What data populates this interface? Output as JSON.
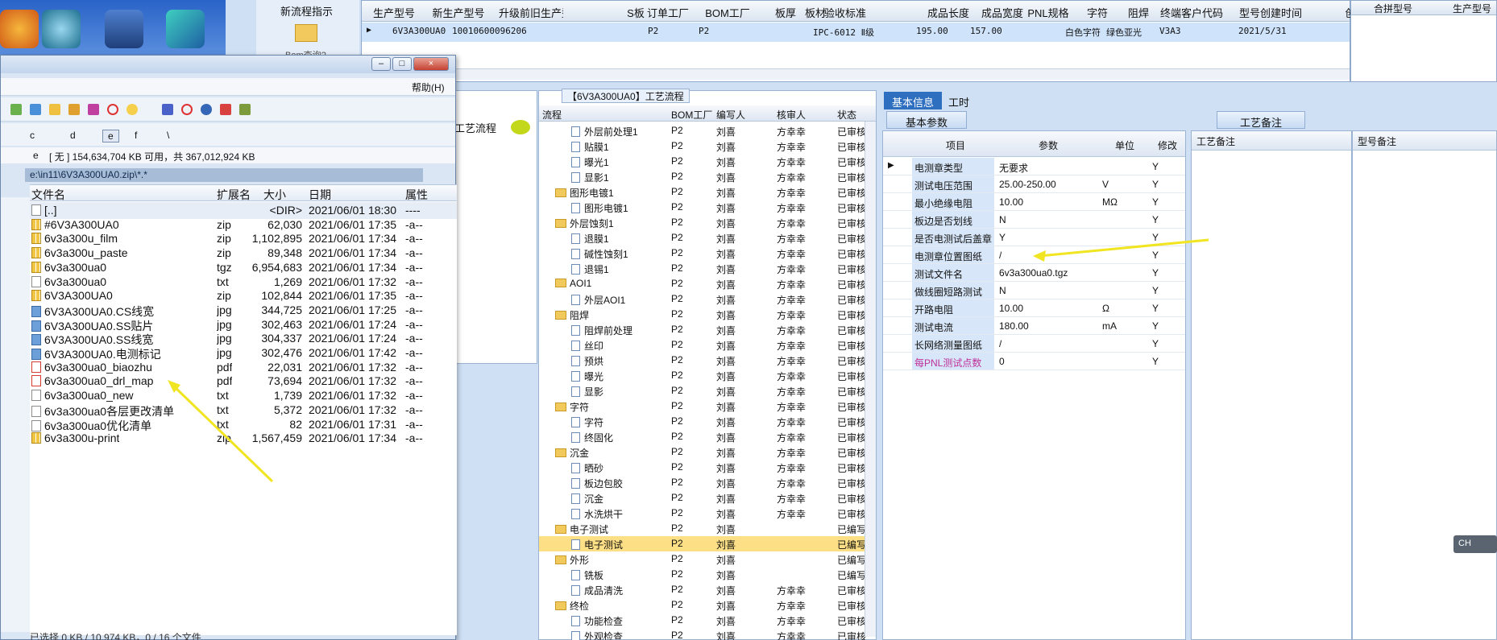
{
  "top_grid": {
    "headers": [
      "生产型号",
      "新生产型号",
      "升级前旧生产型号",
      "S板",
      "订单工厂",
      "BOM工厂",
      "板厚",
      "板材",
      "验收标准",
      "成品长度",
      "成品宽度",
      "PNL规格",
      "字符",
      "阻焊",
      "终端客户代码",
      "型号创建时间",
      "创建人"
    ],
    "row": {
      "model": "6V3A300UA0",
      "new_model": "10010600096206",
      "order_factory": "P2",
      "bom_factory": "P2",
      "standard": "IPC-6012 Ⅱ级",
      "length": "195.00",
      "width": "157.00",
      "char": "白色字符",
      "solder": "绿色亚光",
      "customer": "V3A3",
      "created": "2021/5/31"
    }
  },
  "right_top": {
    "headers": [
      "合拼型号",
      "生产型号"
    ]
  },
  "new_flow": {
    "label": "新流程指示",
    "bom_label": "Bom查询?"
  },
  "left_panel": {
    "label": "工艺流程"
  },
  "flow": {
    "tag": "【6V3A300UA0】工艺流程",
    "headers": [
      "流程",
      "BOM工厂",
      "编写人",
      "核审人",
      "状态"
    ],
    "rows": [
      {
        "name": "外层前处理1",
        "type": "doc",
        "f": "P2",
        "w": "刘喜",
        "a": "方幸幸",
        "s": "已审核"
      },
      {
        "name": "贴膜1",
        "type": "doc",
        "f": "P2",
        "w": "刘喜",
        "a": "方幸幸",
        "s": "已审核"
      },
      {
        "name": "曝光1",
        "type": "doc",
        "f": "P2",
        "w": "刘喜",
        "a": "方幸幸",
        "s": "已审核"
      },
      {
        "name": "显影1",
        "type": "doc",
        "f": "P2",
        "w": "刘喜",
        "a": "方幸幸",
        "s": "已审核"
      },
      {
        "name": "图形电镀1",
        "type": "folder",
        "f": "P2",
        "w": "刘喜",
        "a": "方幸幸",
        "s": "已审核"
      },
      {
        "name": "图形电镀1",
        "type": "doc",
        "f": "P2",
        "w": "刘喜",
        "a": "方幸幸",
        "s": "已审核"
      },
      {
        "name": "外层蚀刻1",
        "type": "folder",
        "f": "P2",
        "w": "刘喜",
        "a": "方幸幸",
        "s": "已审核"
      },
      {
        "name": "退膜1",
        "type": "doc",
        "f": "P2",
        "w": "刘喜",
        "a": "方幸幸",
        "s": "已审核"
      },
      {
        "name": "碱性蚀刻1",
        "type": "doc",
        "f": "P2",
        "w": "刘喜",
        "a": "方幸幸",
        "s": "已审核"
      },
      {
        "name": "退锡1",
        "type": "doc",
        "f": "P2",
        "w": "刘喜",
        "a": "方幸幸",
        "s": "已审核"
      },
      {
        "name": "AOI1",
        "type": "folder",
        "f": "P2",
        "w": "刘喜",
        "a": "方幸幸",
        "s": "已审核"
      },
      {
        "name": "外层AOI1",
        "type": "doc",
        "f": "P2",
        "w": "刘喜",
        "a": "方幸幸",
        "s": "已审核"
      },
      {
        "name": "阻焊",
        "type": "folder",
        "f": "P2",
        "w": "刘喜",
        "a": "方幸幸",
        "s": "已审核"
      },
      {
        "name": "阻焊前处理",
        "type": "doc",
        "f": "P2",
        "w": "刘喜",
        "a": "方幸幸",
        "s": "已审核"
      },
      {
        "name": "丝印",
        "type": "doc",
        "f": "P2",
        "w": "刘喜",
        "a": "方幸幸",
        "s": "已审核"
      },
      {
        "name": "预烘",
        "type": "doc",
        "f": "P2",
        "w": "刘喜",
        "a": "方幸幸",
        "s": "已审核"
      },
      {
        "name": "曝光",
        "type": "doc",
        "f": "P2",
        "w": "刘喜",
        "a": "方幸幸",
        "s": "已审核"
      },
      {
        "name": "显影",
        "type": "doc",
        "f": "P2",
        "w": "刘喜",
        "a": "方幸幸",
        "s": "已审核"
      },
      {
        "name": "字符",
        "type": "folder",
        "f": "P2",
        "w": "刘喜",
        "a": "方幸幸",
        "s": "已审核"
      },
      {
        "name": "字符",
        "type": "doc",
        "f": "P2",
        "w": "刘喜",
        "a": "方幸幸",
        "s": "已审核"
      },
      {
        "name": "终固化",
        "type": "doc",
        "f": "P2",
        "w": "刘喜",
        "a": "方幸幸",
        "s": "已审核"
      },
      {
        "name": "沉金",
        "type": "folder",
        "f": "P2",
        "w": "刘喜",
        "a": "方幸幸",
        "s": "已审核"
      },
      {
        "name": "晒砂",
        "type": "doc",
        "f": "P2",
        "w": "刘喜",
        "a": "方幸幸",
        "s": "已审核"
      },
      {
        "name": "板边包胶",
        "type": "doc",
        "f": "P2",
        "w": "刘喜",
        "a": "方幸幸",
        "s": "已审核"
      },
      {
        "name": "沉金",
        "type": "doc",
        "f": "P2",
        "w": "刘喜",
        "a": "方幸幸",
        "s": "已审核"
      },
      {
        "name": "水洗烘干",
        "type": "doc",
        "f": "P2",
        "w": "刘喜",
        "a": "方幸幸",
        "s": "已审核"
      },
      {
        "name": "电子测试",
        "type": "folder",
        "f": "P2",
        "w": "刘喜",
        "a": "",
        "s": "已编写"
      },
      {
        "name": "电子测试",
        "type": "doc",
        "f": "P2",
        "w": "刘喜",
        "a": "",
        "s": "已编写",
        "sel": true
      },
      {
        "name": "外形",
        "type": "folder",
        "f": "P2",
        "w": "刘喜",
        "a": "",
        "s": "已编写"
      },
      {
        "name": "铣板",
        "type": "doc",
        "f": "P2",
        "w": "刘喜",
        "a": "",
        "s": "已编写"
      },
      {
        "name": "成品清洗",
        "type": "doc",
        "f": "P2",
        "w": "刘喜",
        "a": "方幸幸",
        "s": "已审核"
      },
      {
        "name": "终检",
        "type": "folder",
        "f": "P2",
        "w": "刘喜",
        "a": "方幸幸",
        "s": "已审核"
      },
      {
        "name": "功能检查",
        "type": "doc",
        "f": "P2",
        "w": "刘喜",
        "a": "方幸幸",
        "s": "已审核"
      },
      {
        "name": "外观检查",
        "type": "doc",
        "f": "P2",
        "w": "刘喜",
        "a": "方幸幸",
        "s": "已审核"
      }
    ]
  },
  "params": {
    "tabs": [
      "基本信息",
      "工时"
    ],
    "subtab": "基本参数",
    "headers": [
      "项目",
      "参数",
      "单位",
      "修改"
    ],
    "rows": [
      {
        "k": "电测章类型",
        "v": "无要求",
        "u": "",
        "m": "Y"
      },
      {
        "k": "测试电压范围",
        "v": "25.00-250.00",
        "u": "V",
        "m": "Y"
      },
      {
        "k": "最小绝缘电阻",
        "v": "10.00",
        "u": "MΩ",
        "m": "Y"
      },
      {
        "k": "板边是否划线",
        "v": "N",
        "u": "",
        "m": "Y"
      },
      {
        "k": "是否电测试后盖章",
        "v": "Y",
        "u": "",
        "m": "Y"
      },
      {
        "k": "电测章位置图纸",
        "v": "/",
        "u": "",
        "m": "Y"
      },
      {
        "k": "测试文件名",
        "v": "6v3a300ua0.tgz",
        "u": "",
        "m": "Y"
      },
      {
        "k": "做线圈短路测试",
        "v": "N",
        "u": "",
        "m": "Y"
      },
      {
        "k": "开路电阻",
        "v": "10.00",
        "u": "Ω",
        "m": "Y"
      },
      {
        "k": "测试电流",
        "v": "180.00",
        "u": "mA",
        "m": "Y"
      },
      {
        "k": "长网络测量图纸",
        "v": "/",
        "u": "",
        "m": "Y"
      },
      {
        "k": "每PNL测试点数",
        "v": "0",
        "u": "",
        "m": "Y"
      }
    ]
  },
  "remarks": {
    "tab": "工艺备注",
    "col1": "工艺备注",
    "col2": "型号备注"
  },
  "fm": {
    "menu_help": "帮助(H)",
    "drive_label": "e",
    "free_text": "[ 无 ]  154,634,704 KB 可用，共 367,012,924 KB",
    "path": "e:\\in11\\6V3A300UA0.zip\\*.*",
    "drives": [
      "c",
      "d",
      "e",
      "f",
      "\\"
    ],
    "headers": [
      "文件名",
      "扩展名",
      "大小",
      "日期",
      "属性"
    ],
    "files": [
      {
        "n": "[..]",
        "e": "",
        "s": "<DIR>",
        "d": "2021/06/01 18:30",
        "a": "----",
        "t": "up"
      },
      {
        "n": "#6V3A300UA0",
        "e": "zip",
        "s": "62,030",
        "d": "2021/06/01 17:35",
        "a": "-a--",
        "t": "zip"
      },
      {
        "n": "6v3a300u_film",
        "e": "zip",
        "s": "1,102,895",
        "d": "2021/06/01 17:34",
        "a": "-a--",
        "t": "zip"
      },
      {
        "n": "6v3a300u_paste",
        "e": "zip",
        "s": "89,348",
        "d": "2021/06/01 17:34",
        "a": "-a--",
        "t": "zip"
      },
      {
        "n": "6v3a300ua0",
        "e": "tgz",
        "s": "6,954,683",
        "d": "2021/06/01 17:34",
        "a": "-a--",
        "t": "zip"
      },
      {
        "n": "6v3a300ua0",
        "e": "txt",
        "s": "1,269",
        "d": "2021/06/01 17:32",
        "a": "-a--",
        "t": "txt"
      },
      {
        "n": "6V3A300UA0",
        "e": "zip",
        "s": "102,844",
        "d": "2021/06/01 17:35",
        "a": "-a--",
        "t": "zip"
      },
      {
        "n": "6V3A300UA0.CS线宽",
        "e": "jpg",
        "s": "344,725",
        "d": "2021/06/01 17:25",
        "a": "-a--",
        "t": "jpg"
      },
      {
        "n": "6V3A300UA0.SS贴片",
        "e": "jpg",
        "s": "302,463",
        "d": "2021/06/01 17:24",
        "a": "-a--",
        "t": "jpg"
      },
      {
        "n": "6V3A300UA0.SS线宽",
        "e": "jpg",
        "s": "304,337",
        "d": "2021/06/01 17:24",
        "a": "-a--",
        "t": "jpg"
      },
      {
        "n": "6V3A300UA0.电测标记",
        "e": "jpg",
        "s": "302,476",
        "d": "2021/06/01 17:42",
        "a": "-a--",
        "t": "jpg"
      },
      {
        "n": "6v3a300ua0_biaozhu",
        "e": "pdf",
        "s": "22,031",
        "d": "2021/06/01 17:32",
        "a": "-a--",
        "t": "pdf"
      },
      {
        "n": "6v3a300ua0_drl_map",
        "e": "pdf",
        "s": "73,694",
        "d": "2021/06/01 17:32",
        "a": "-a--",
        "t": "pdf"
      },
      {
        "n": "6v3a300ua0_new",
        "e": "txt",
        "s": "1,739",
        "d": "2021/06/01 17:32",
        "a": "-a--",
        "t": "txt"
      },
      {
        "n": "6v3a300ua0各层更改清单",
        "e": "txt",
        "s": "5,372",
        "d": "2021/06/01 17:32",
        "a": "-a--",
        "t": "txt"
      },
      {
        "n": "6v3a300ua0优化清单",
        "e": "txt",
        "s": "82",
        "d": "2021/06/01 17:31",
        "a": "-a--",
        "t": "txt"
      },
      {
        "n": "6v3a300u-print",
        "e": "zip",
        "s": "1,567,459",
        "d": "2021/06/01 17:34",
        "a": "-a--",
        "t": "zip"
      }
    ],
    "status": "已选择 0 KB / 10,974 KB，0 / 16 个文件"
  },
  "ime": "CH"
}
